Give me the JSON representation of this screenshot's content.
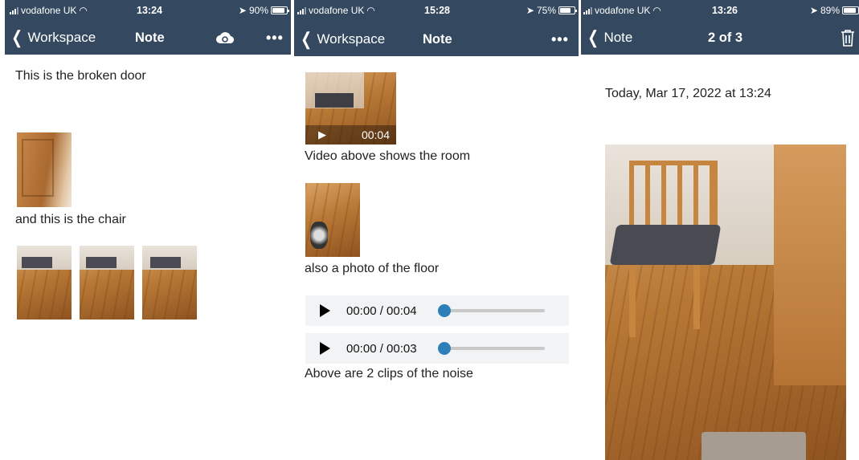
{
  "screens": [
    {
      "status": {
        "carrier": "vodafone UK",
        "time": "13:24",
        "battery": "90%",
        "battery_level": 0.9
      },
      "nav": {
        "back_label": "Workspace",
        "title": "Note",
        "icons": [
          "cloud-sync-icon",
          "more-icon"
        ]
      },
      "content": {
        "text1": "This is the broken door",
        "text2": "and this is the chair"
      }
    },
    {
      "status": {
        "carrier": "vodafone UK",
        "time": "15:28",
        "battery": "75%",
        "battery_level": 0.75
      },
      "nav": {
        "back_label": "Workspace",
        "title": "Note",
        "icons": [
          "more-icon"
        ]
      },
      "content": {
        "video_duration": "00:04",
        "text1": "Video above shows the room",
        "text2": "also a photo of the floor",
        "audio": [
          {
            "time": "00:00 / 00:04",
            "progress": 0
          },
          {
            "time": "00:00 / 00:03",
            "progress": 0
          }
        ],
        "text3": "Above are 2 clips of the noise"
      }
    },
    {
      "status": {
        "carrier": "vodafone UK",
        "time": "13:26",
        "battery": "89%",
        "battery_level": 0.89
      },
      "nav": {
        "back_label": "Note",
        "title": "2 of 3",
        "icons": [
          "trash-icon"
        ]
      },
      "content": {
        "date": "Today, Mar 17, 2022 at 13:24"
      }
    }
  ]
}
